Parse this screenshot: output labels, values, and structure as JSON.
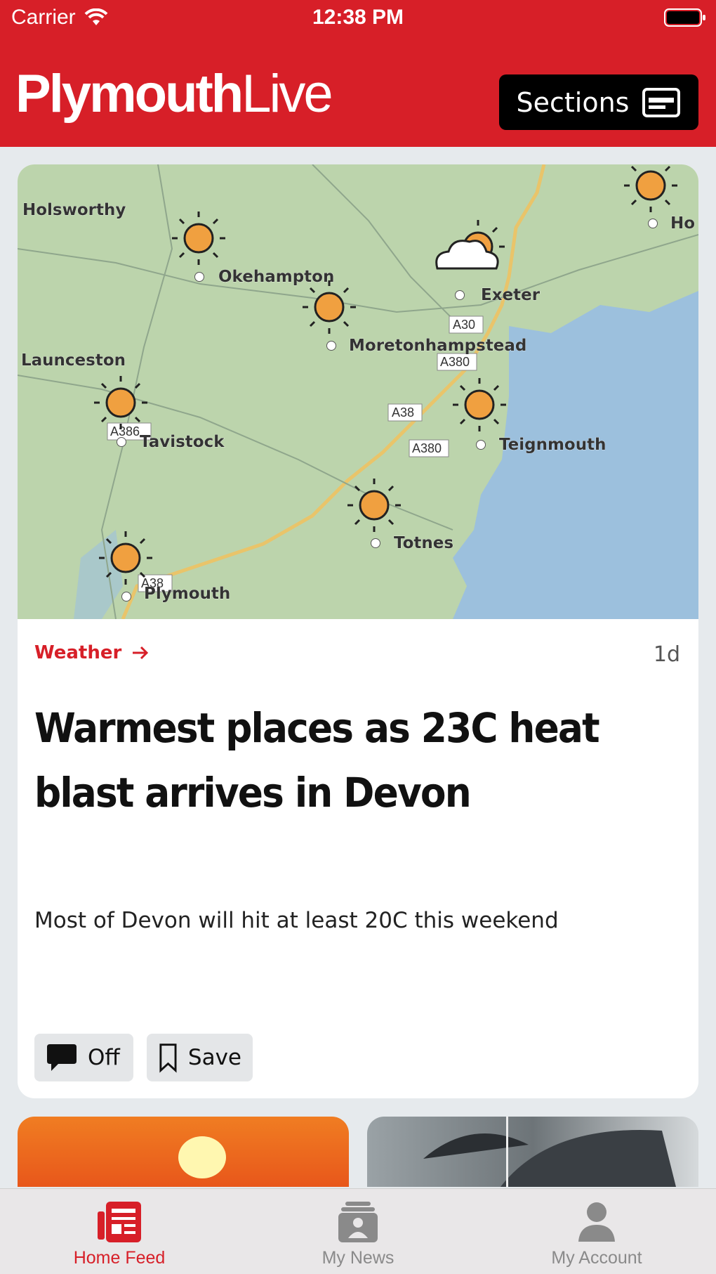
{
  "status": {
    "carrier": "Carrier",
    "time": "12:38 PM"
  },
  "header": {
    "logo_bold": "Plymouth",
    "logo_light": "Live",
    "sections_label": "Sections"
  },
  "article": {
    "category": "Weather",
    "age": "1d",
    "headline": "Warmest places as 23C heat blast arrives in Devon",
    "summary": "Most of Devon will hit at least 20C this weekend",
    "comments_label": "Off",
    "save_label": "Save",
    "map": {
      "places": [
        "Holsworthy",
        "Okehampton",
        "Exeter",
        "Moretonhampstead",
        "Launceston",
        "Tavistock",
        "Teignmouth",
        "Totnes",
        "Plymouth",
        "Ho"
      ],
      "roads": [
        "A30",
        "A380",
        "A38",
        "A386",
        "A380",
        "A38"
      ]
    }
  },
  "tabs": [
    {
      "label": "Home Feed",
      "active": true
    },
    {
      "label": "My News",
      "active": false
    },
    {
      "label": "My Account",
      "active": false
    }
  ],
  "colors": {
    "brand": "#d71f28",
    "background": "#e6eaed",
    "sun": "#f0a040",
    "sea": "#9cc0dd",
    "land": "#bcd4ac"
  }
}
